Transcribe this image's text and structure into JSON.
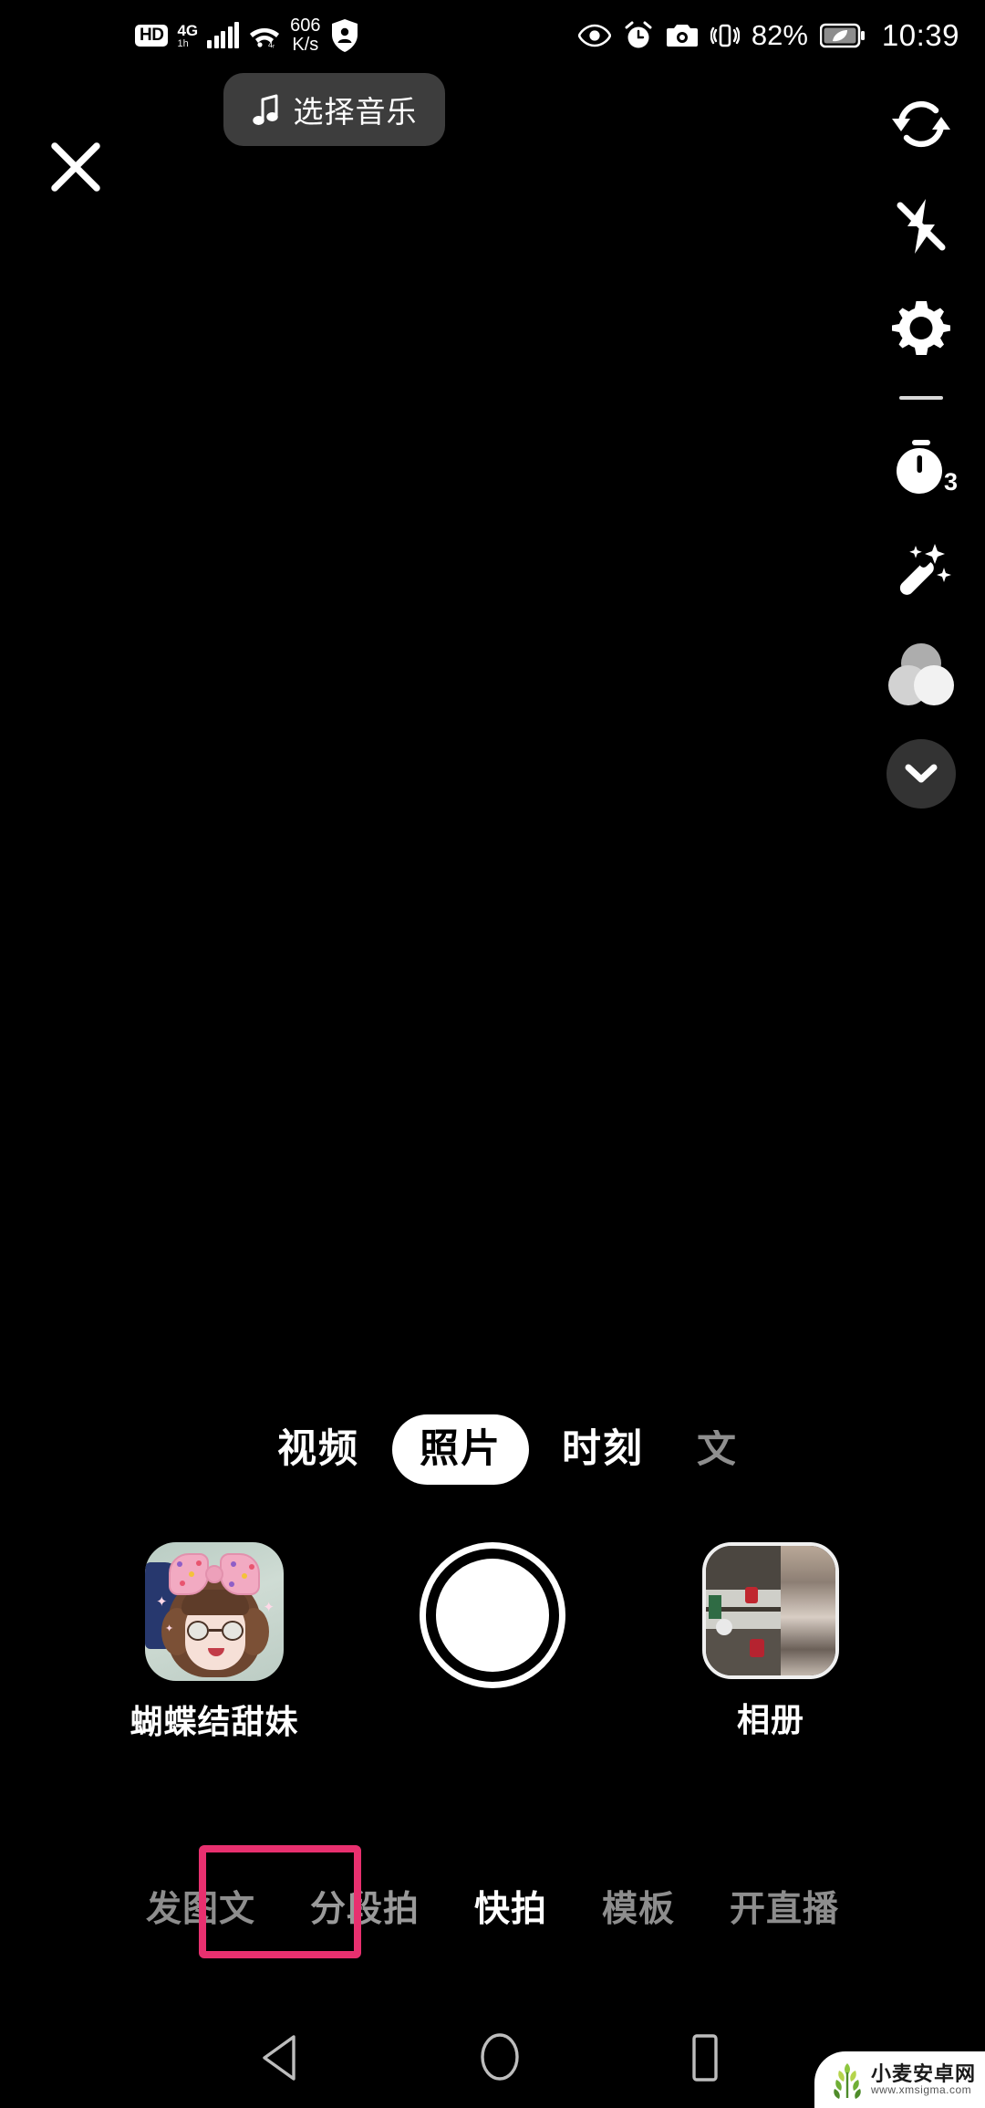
{
  "status_bar": {
    "hd_badge": "HD",
    "network_type": "4G",
    "network_sub": "1h",
    "net_speed_value": "606",
    "net_speed_unit": "K/s",
    "battery_percent": "82%",
    "time": "10:39",
    "icons_left": [
      "hd-badge",
      "4g-signal-icon",
      "signal-bars-icon",
      "wifi-icon",
      "net-speed",
      "shield-person-icon"
    ],
    "icons_right": [
      "eye-icon",
      "alarm-clock-icon",
      "camera-icon",
      "vibrate-icon",
      "battery-saver-icon"
    ]
  },
  "top_bar": {
    "close_label": "close-icon",
    "music_button_label": "选择音乐",
    "music_icon": "music-note-icon"
  },
  "tool_rail": [
    {
      "name": "flip-camera",
      "icon": "flip-camera-icon",
      "label": ""
    },
    {
      "name": "flash-off",
      "icon": "flash-off-icon",
      "label": ""
    },
    {
      "name": "settings",
      "icon": "gear-icon",
      "label": ""
    },
    {
      "name": "divider",
      "icon": "divider",
      "label": ""
    },
    {
      "name": "timer",
      "icon": "timer-icon",
      "label": "3"
    },
    {
      "name": "beautify",
      "icon": "magic-wand-icon",
      "label": ""
    },
    {
      "name": "filters",
      "icon": "filter-circles-icon",
      "label": ""
    },
    {
      "name": "collapse",
      "icon": "chevron-down-icon",
      "label": ""
    }
  ],
  "modes": [
    {
      "label": "视频",
      "active": false
    },
    {
      "label": "照片",
      "active": true
    },
    {
      "label": "时刻",
      "active": false
    },
    {
      "label": "文",
      "active": false
    }
  ],
  "capture": {
    "effect": {
      "label": "蝴蝶结甜妹",
      "thumb": "bow-sweet-girl-effect-thumbnail"
    },
    "shutter": "shutter-button",
    "album": {
      "label": "相册",
      "thumb": "album-preview-thumbnail"
    }
  },
  "bottom_tabs": [
    {
      "label": "发图文",
      "active": false,
      "highlighted": false
    },
    {
      "label": "分段拍",
      "active": false,
      "highlighted": true
    },
    {
      "label": "快拍",
      "active": true,
      "highlighted": false
    },
    {
      "label": "模板",
      "active": false,
      "highlighted": false
    },
    {
      "label": "开直播",
      "active": false,
      "highlighted": false
    }
  ],
  "nav_bar": {
    "back": "back-triangle-icon",
    "home": "home-circle-icon",
    "recents": "recents-square-icon"
  },
  "watermark": {
    "site_name": "小麦安卓网",
    "url": "www.xmsigma.com",
    "icon": "wheat-icon"
  },
  "colors": {
    "background": "#000000",
    "highlight_pink": "#e8306f",
    "pill_gray": "#3d3d3d",
    "inactive_text": "#8d8d8d",
    "active_text": "#ffffff"
  }
}
